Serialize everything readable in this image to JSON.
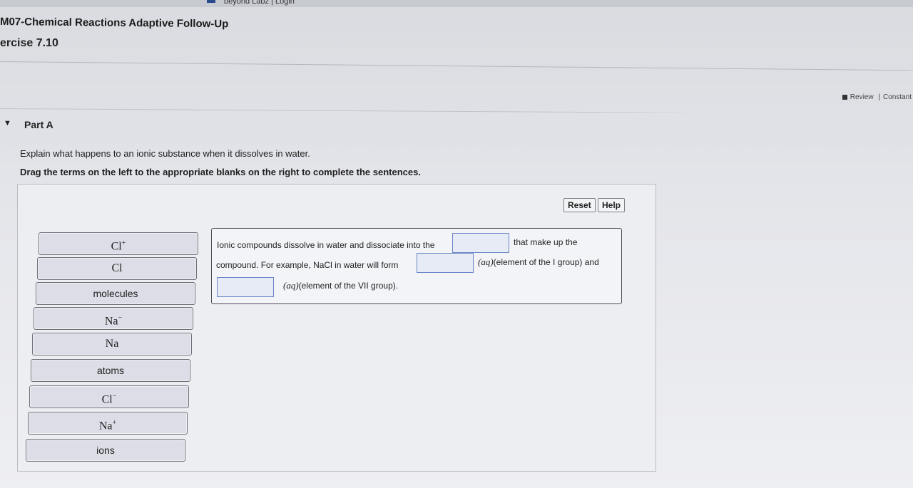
{
  "top": {
    "login_link": "beyond Labz | Login"
  },
  "header": {
    "assignment_title": "M07-Chemical Reactions Adaptive Follow-Up",
    "exercise": "ercise 7.10",
    "review": "Review",
    "separator": "|",
    "constants": "Constant"
  },
  "part": {
    "caret": "▼",
    "title": "Part A",
    "question": "Explain what happens to an ionic substance when it dissolves in water.",
    "instructions": "Drag the terms on the left to the appropriate blanks on the right to complete the sentences."
  },
  "buttons": {
    "reset": "Reset",
    "help": "Help"
  },
  "terms": [
    {
      "label": "Cl",
      "sup": "+"
    },
    {
      "label": "Cl",
      "sup": ""
    },
    {
      "label": "molecules",
      "sup": ""
    },
    {
      "label": "Na",
      "sup": "−"
    },
    {
      "label": "Na",
      "sup": ""
    },
    {
      "label": "atoms",
      "sup": ""
    },
    {
      "label": "Cl",
      "sup": "−"
    },
    {
      "label": "Na",
      "sup": "+"
    },
    {
      "label": "ions",
      "sup": ""
    }
  ],
  "sentences": {
    "s1_a": "Ionic compounds dissolve in water and dissociate into the",
    "s1_b": "that make up the",
    "s2_a": "compound. For example, NaCl in water will form",
    "aq": "(aq)",
    "s2_b": "(element of the I group) and",
    "s3_b": "(element of the VII group)."
  },
  "colors": {
    "term_bg": "#dcdde6",
    "blank_border": "#6b85c8"
  }
}
